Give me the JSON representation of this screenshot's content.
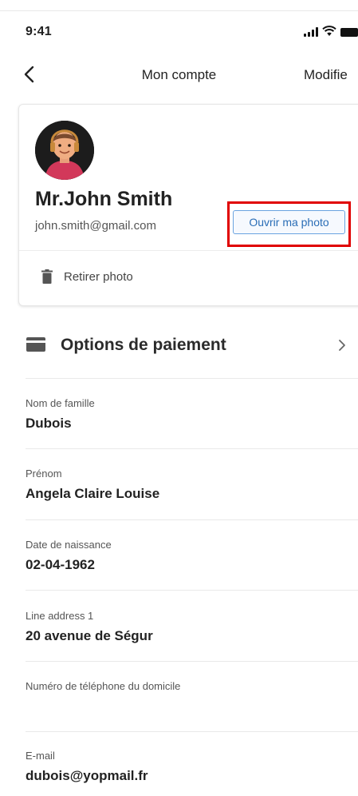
{
  "status_bar": {
    "time": "9:41"
  },
  "nav": {
    "title": "Mon compte",
    "edit_label": "Modifie"
  },
  "profile": {
    "name": "Mr.John Smith",
    "email": "john.smith@gmail.com",
    "open_photo_label": "Ouvrir ma photo",
    "remove_photo_label": "Retirer photo"
  },
  "payment": {
    "label": "Options de paiement"
  },
  "fields": [
    {
      "label": "Nom de famille",
      "value": "Dubois"
    },
    {
      "label": "Prénom",
      "value": "Angela Claire Louise"
    },
    {
      "label": "Date de naissance",
      "value": "02-04-1962"
    },
    {
      "label": "Line address 1",
      "value": "20 avenue de Ségur"
    },
    {
      "label": "Numéro de téléphone du domicile",
      "value": ""
    },
    {
      "label": "E-mail",
      "value": "dubois@yopmail.fr"
    }
  ],
  "icons": {
    "back": "chevron-left-icon",
    "trash": "trash-icon",
    "card": "credit-card-icon",
    "chevron": "chevron-right-icon",
    "signal": "signal-icon",
    "wifi": "wifi-icon",
    "battery": "battery-icon"
  },
  "colors": {
    "highlight": "#e00000",
    "button_border": "#6aa3e0",
    "button_text": "#2a6db6"
  }
}
